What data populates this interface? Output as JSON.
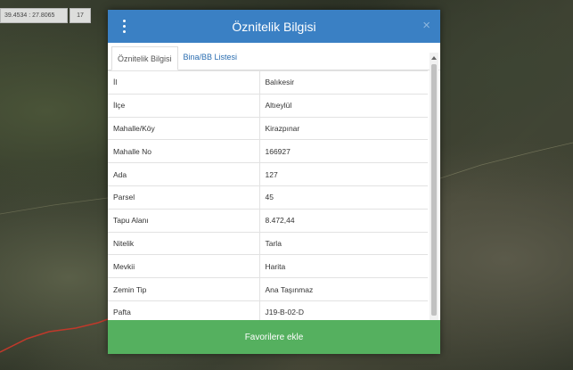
{
  "map": {
    "coordinates": "39.4534 : 27.8065",
    "zoom": "17"
  },
  "modal": {
    "title": "Öznitelik Bilgisi",
    "close_symbol": "×",
    "icons": {
      "menu": "vertical-dots-icon",
      "close": "close-icon"
    },
    "tabs": [
      {
        "label": "Öznitelik Bilgisi",
        "active": true
      },
      {
        "label": "Bina/BB Listesi",
        "active": false
      }
    ],
    "rows": [
      {
        "key": "İl",
        "value": "Balıkesir"
      },
      {
        "key": "İlçe",
        "value": "Altıeylül"
      },
      {
        "key": "Mahalle/Köy",
        "value": "Kirazpınar"
      },
      {
        "key": "Mahalle No",
        "value": "166927"
      },
      {
        "key": "Ada",
        "value": "127"
      },
      {
        "key": "Parsel",
        "value": "45"
      },
      {
        "key": "Tapu Alanı",
        "value": "8.472,44"
      },
      {
        "key": "Nitelik",
        "value": "Tarla"
      },
      {
        "key": "Mevkii",
        "value": "Harita"
      },
      {
        "key": "Zemin Tip",
        "value": "Ana Taşınmaz"
      },
      {
        "key": "Pafta",
        "value": "J19-B-02-D"
      }
    ],
    "favorite_button": "Favorilere ekle"
  },
  "colors": {
    "header": "#3a80c4",
    "button": "#55b05f",
    "link": "#2a6db0"
  }
}
